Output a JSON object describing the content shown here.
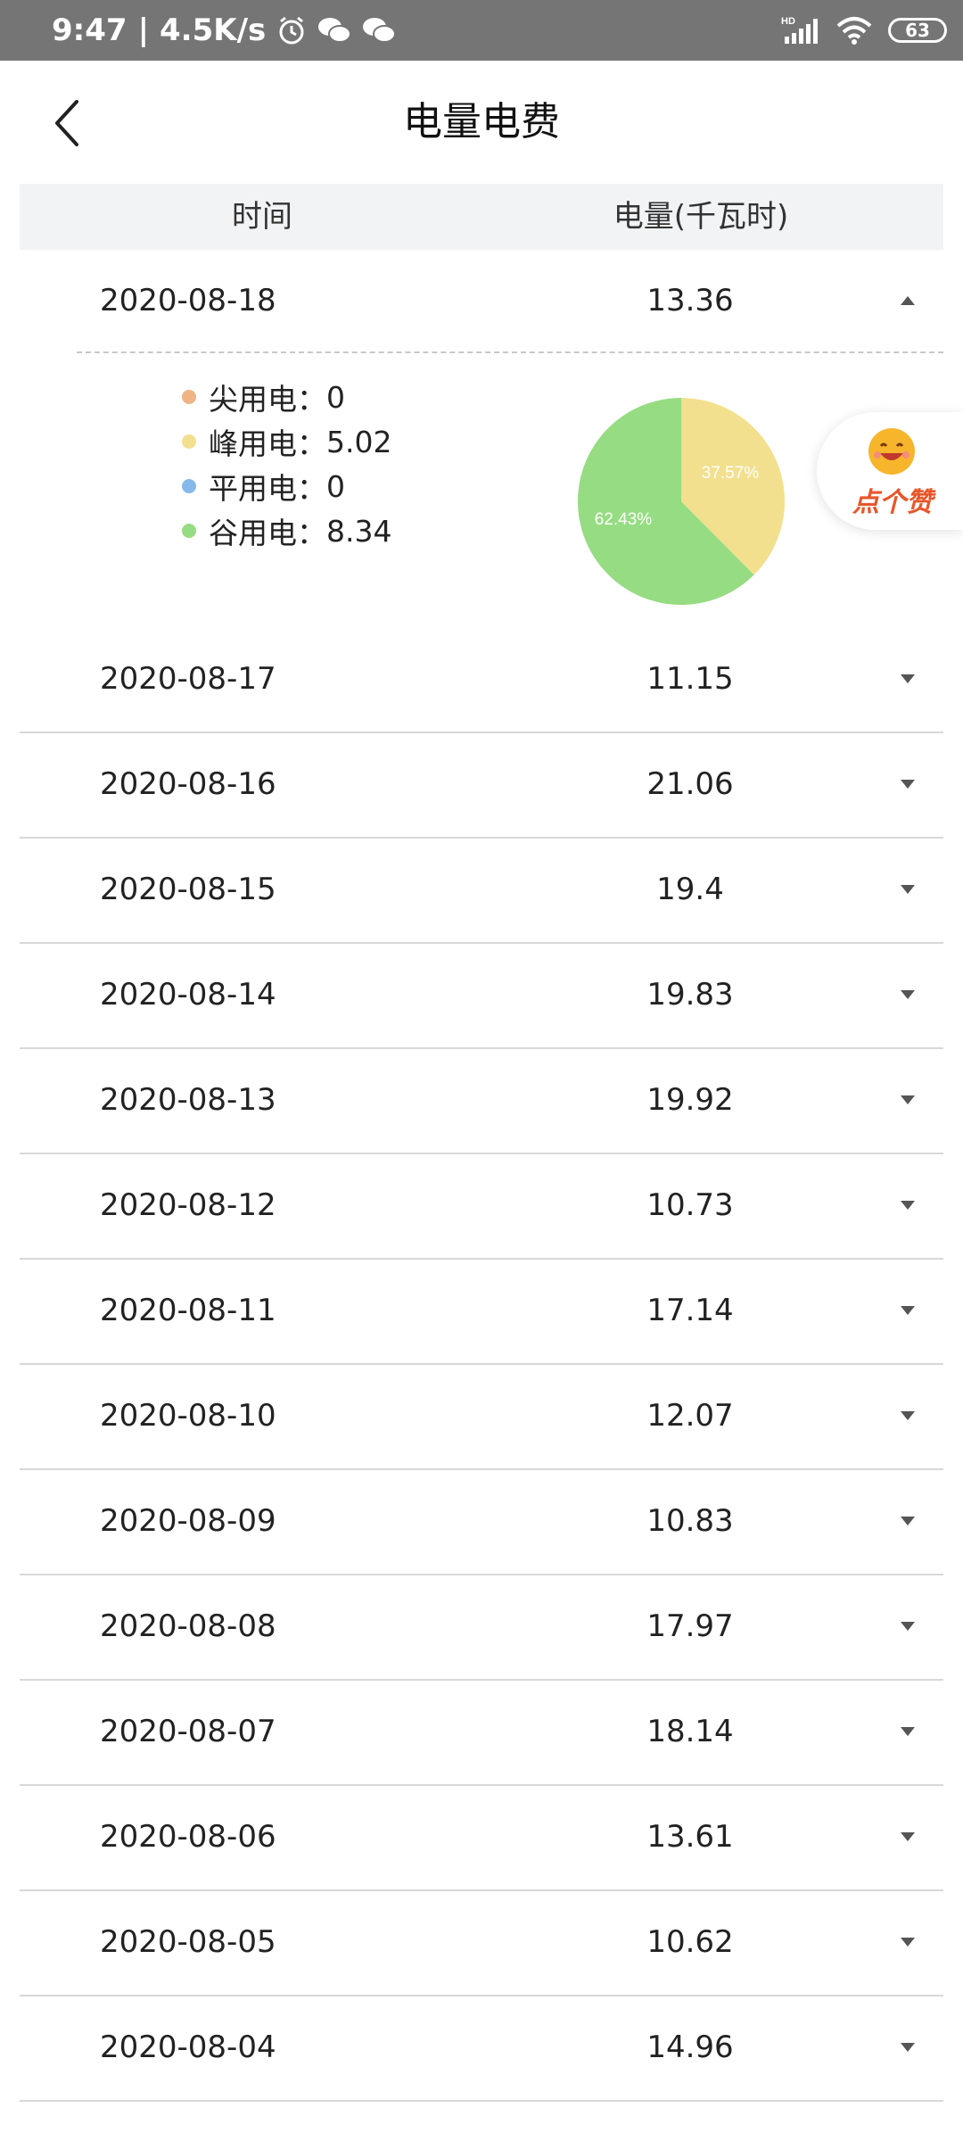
{
  "status_bar": {
    "time": "9:47",
    "speed": "4.5K/s",
    "battery": "63",
    "network": "HD"
  },
  "header": {
    "title": "电量电费"
  },
  "table": {
    "col_time": "时间",
    "col_amount": "电量(千瓦时)",
    "expanded": {
      "date": "2020-08-18",
      "value": "13.36",
      "breakdown": [
        {
          "label": "尖用电：",
          "value": "0",
          "color": "#eeb486"
        },
        {
          "label": "峰用电：",
          "value": "5.02",
          "color": "#f2e08e"
        },
        {
          "label": "平用电：",
          "value": "0",
          "color": "#86b8ec"
        },
        {
          "label": "谷用电：",
          "value": "8.34",
          "color": "#96dc82"
        }
      ],
      "pie": {
        "peak_pct": "37.57%",
        "valley_pct": "62.43%",
        "peak_fraction": 0.3757
      }
    },
    "rows": [
      {
        "date": "2020-08-17",
        "value": "11.15"
      },
      {
        "date": "2020-08-16",
        "value": "21.06"
      },
      {
        "date": "2020-08-15",
        "value": "19.4"
      },
      {
        "date": "2020-08-14",
        "value": "19.83"
      },
      {
        "date": "2020-08-13",
        "value": "19.92"
      },
      {
        "date": "2020-08-12",
        "value": "10.73"
      },
      {
        "date": "2020-08-11",
        "value": "17.14"
      },
      {
        "date": "2020-08-10",
        "value": "12.07"
      },
      {
        "date": "2020-08-09",
        "value": "10.83"
      },
      {
        "date": "2020-08-08",
        "value": "17.97"
      },
      {
        "date": "2020-08-07",
        "value": "18.14"
      },
      {
        "date": "2020-08-06",
        "value": "13.61"
      },
      {
        "date": "2020-08-05",
        "value": "10.62"
      },
      {
        "date": "2020-08-04",
        "value": "14.96"
      }
    ]
  },
  "float_button": {
    "label": "点个赞"
  }
}
